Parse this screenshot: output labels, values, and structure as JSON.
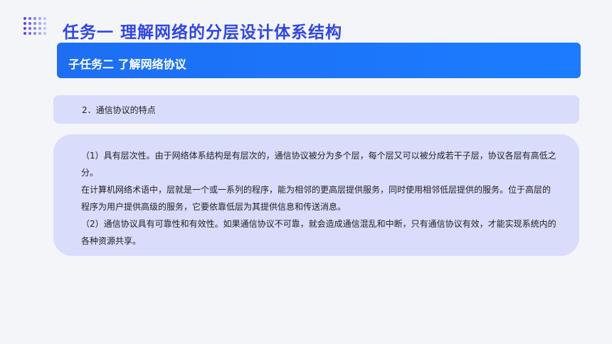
{
  "header": {
    "title": "任务一  理解网络的分层设计体系结构",
    "subtitle": "子任务二  了解网络协议"
  },
  "section": {
    "heading": "2．通信协议的特点"
  },
  "content": {
    "paragraphs": [
      "（1）具有层次性。由于网络体系结构是有层次的，通信协议被分为多个层，每个层又可以被分成若干子层，协议各层有高低之分。",
      "在计算机网络术语中，层就是一个或一系列的程序，能为相邻的更高层提供服务，同时使用相邻低层提供的服务。位于高层的程序为用户提供高级的服务，它要依靠低层为其提供信息和传送消息。",
      "（2）通信协议具有可靠性和有效性。如果通信协议不可靠，就会造成通信混乱和中断，只有通信协议有效，才能实现系统内的各种资源共享。"
    ]
  },
  "colors": {
    "title": "#2f46e6",
    "banner": "#1d6ef3",
    "panel": "#d9dcfb",
    "dots_start": "#5b3ef0",
    "dots_end": "#b8c2f5"
  }
}
